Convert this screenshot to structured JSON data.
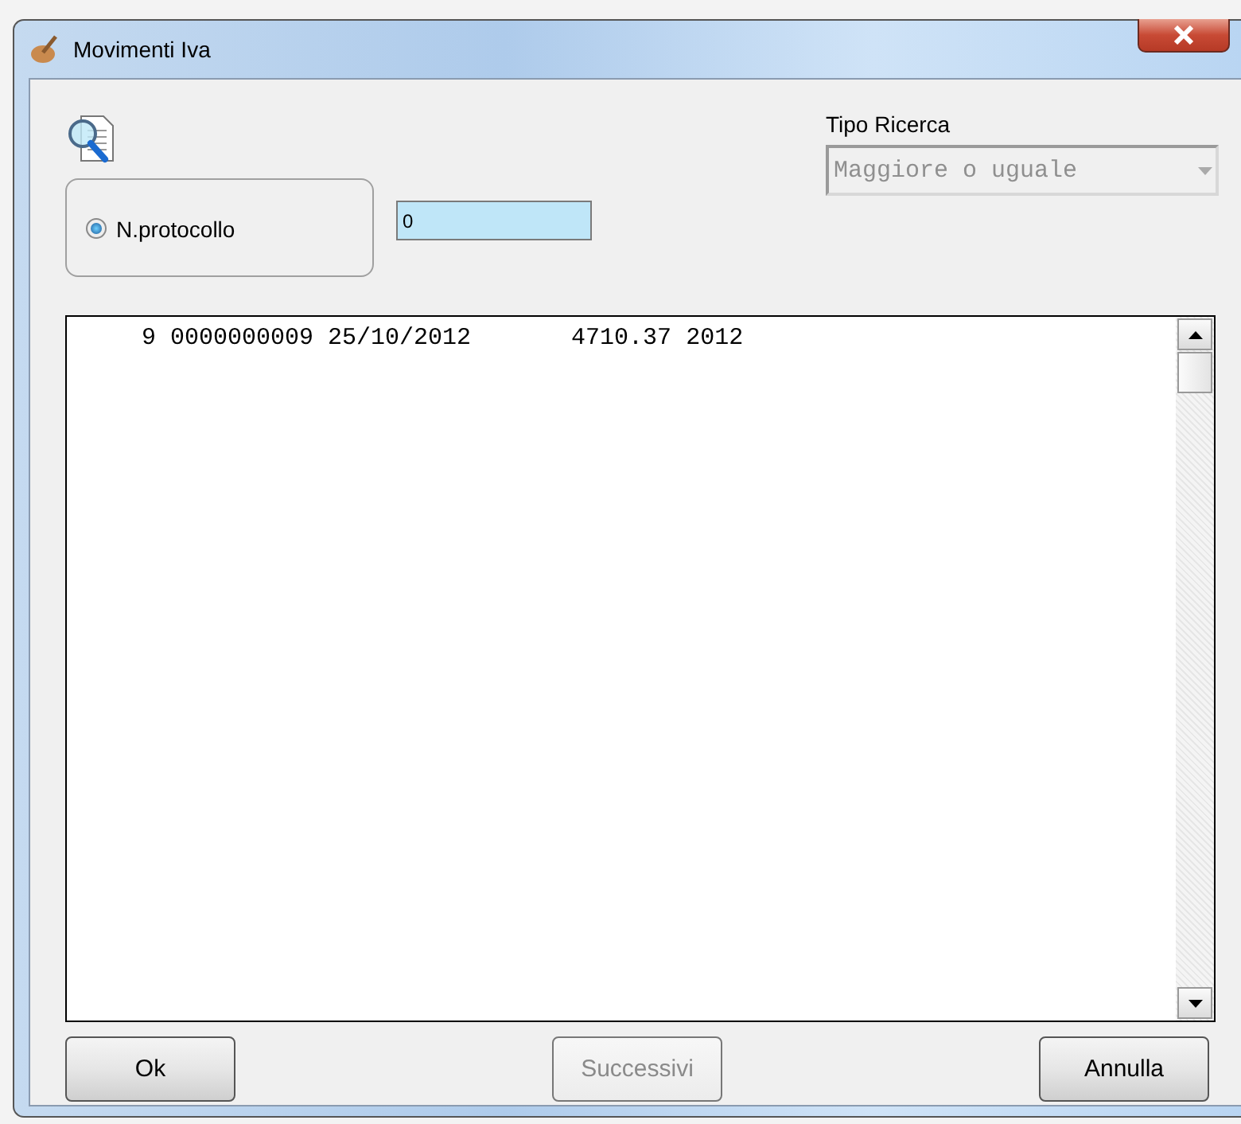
{
  "window": {
    "title": "Movimenti Iva"
  },
  "search_mode": {
    "label": "N.protocollo",
    "selected": true
  },
  "search_value": {
    "value": "0"
  },
  "search_type": {
    "label": "Tipo Ricerca",
    "value": "Maggiore o uguale",
    "disabled": true
  },
  "results": {
    "rows": [
      {
        "text": "     9 0000000009 25/10/2012       4710.37 2012"
      }
    ]
  },
  "buttons": [
    {
      "label": "Ok",
      "disabled": false
    },
    {
      "label": "Successivi",
      "disabled": true
    },
    {
      "label": "Annulla",
      "disabled": false
    }
  ]
}
